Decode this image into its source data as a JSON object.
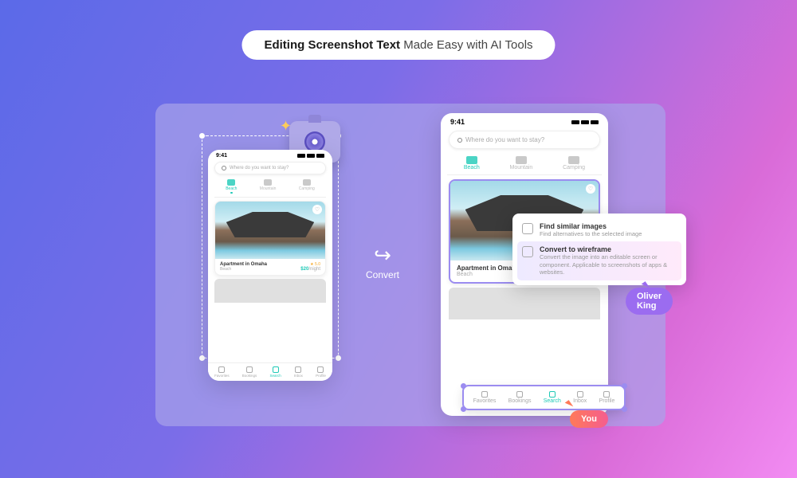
{
  "title": {
    "bold": "Editing Screenshot Text",
    "rest": " Made Easy with AI Tools"
  },
  "convert_label": "Convert",
  "phone": {
    "time": "9:41",
    "search_placeholder": "Where do you want to stay?",
    "tabs": [
      {
        "label": "Beach",
        "active": true
      },
      {
        "label": "Mountain",
        "active": false
      },
      {
        "label": "Camping",
        "active": false
      }
    ],
    "card": {
      "title": "Apartment in Omaha",
      "subtitle": "Beach",
      "rating": "★ 5.0",
      "price": "$20",
      "per": "/night"
    },
    "nav": [
      {
        "label": "Favorites",
        "active": false
      },
      {
        "label": "Bookings",
        "active": false
      },
      {
        "label": "Search",
        "active": true
      },
      {
        "label": "Inbox",
        "active": false
      },
      {
        "label": "Profile",
        "active": false
      }
    ]
  },
  "context_menu": [
    {
      "title": "Find similar images",
      "desc": "Find alternatives to the selected image"
    },
    {
      "title": "Convert to wireframe",
      "desc": "Convert the image into an editable screen or component. Applicable to screenshots of apps & websites."
    }
  ],
  "users": {
    "collaborator": "Oliver King",
    "self": "You"
  }
}
